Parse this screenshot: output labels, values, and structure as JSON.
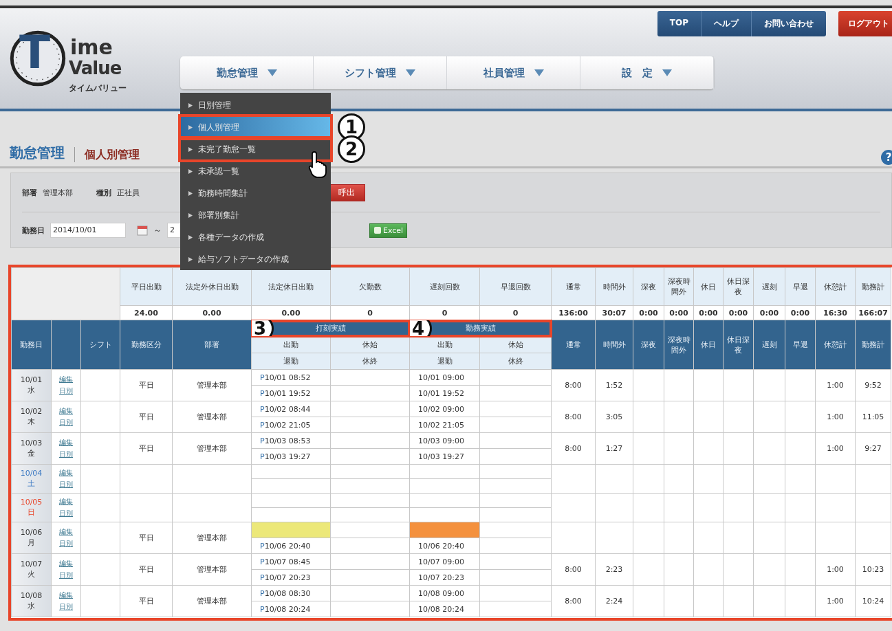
{
  "logo": {
    "letter": "T",
    "line1": "ime",
    "line2": "Value",
    "kana": "タイムバリュー"
  },
  "top_links": [
    {
      "label": "TOP"
    },
    {
      "label": "ヘルプ"
    },
    {
      "label": "お問い合わせ"
    }
  ],
  "logout": "ログアウト",
  "nav": [
    {
      "label": "勤怠管理"
    },
    {
      "label": "シフト管理"
    },
    {
      "label": "社員管理"
    },
    {
      "label": "設　定"
    }
  ],
  "dropdown": [
    {
      "label": "日別管理",
      "selected": false
    },
    {
      "label": "個人別管理",
      "selected": true,
      "callout": "1"
    },
    {
      "label": "未完了勤怠一覧",
      "selected": false,
      "callout": "2"
    },
    {
      "label": "未承認一覧",
      "selected": false
    },
    {
      "label": "勤務時間集計",
      "selected": false
    },
    {
      "label": "部署別集計",
      "selected": false
    },
    {
      "label": "各種データの作成",
      "selected": false
    },
    {
      "label": "給与ソフトデータの作成",
      "selected": false
    }
  ],
  "breadcrumb": {
    "section": "勤怠管理",
    "page": "個人別管理",
    "help": "?"
  },
  "filters": {
    "dept_label": "部署",
    "dept": "管理本部",
    "type_label": "種別",
    "type": "正社員",
    "call_button": "呼出",
    "date_label": "勤務日",
    "date_from": "2014/10/01",
    "range_sep": "～",
    "date_to": "2",
    "excel_button": "Excel"
  },
  "summary": [
    {
      "label": "平日出勤",
      "value": "24.00"
    },
    {
      "label": "法定外休日出勤",
      "value": "0.00"
    },
    {
      "label": "法定休日出勤",
      "value": "0.00"
    },
    {
      "label": "欠勤数",
      "value": "0"
    },
    {
      "label": "遅刻回数",
      "value": "0"
    },
    {
      "label": "早退回数",
      "value": "0"
    },
    {
      "label": "通常",
      "value": "136:00"
    },
    {
      "label": "時間外",
      "value": "30:07"
    },
    {
      "label": "深夜",
      "value": "0:00"
    },
    {
      "label": "深夜時間外",
      "value": "0:00"
    },
    {
      "label": "休日",
      "value": "0:00"
    },
    {
      "label": "休日深夜",
      "value": "0:00"
    },
    {
      "label": "遅刻",
      "value": "0:00"
    },
    {
      "label": "早退",
      "value": "0:00"
    },
    {
      "label": "休憩計",
      "value": "16:30"
    },
    {
      "label": "勤務計",
      "value": "166:07"
    }
  ],
  "headers": {
    "date": "勤務日",
    "shift": "シフト",
    "work_type": "勤務区分",
    "dept": "部署",
    "groups": [
      {
        "label": "打刻実績",
        "callout": "3",
        "in": "出勤",
        "break_start": "休始",
        "out": "退勤",
        "break_end": "休終"
      },
      {
        "label": "勤務実績",
        "callout": "4",
        "in": "出勤",
        "break_start": "休始",
        "out": "退勤",
        "break_end": "休終"
      }
    ],
    "totals": [
      "通常",
      "時間外",
      "深夜",
      "深夜時間外",
      "休日",
      "休日深夜",
      "遅刻",
      "早退",
      "休憩計",
      "勤務計"
    ]
  },
  "rows": [
    {
      "date": "10/01",
      "weekday": "水",
      "kind": "weekday",
      "edit": "編集",
      "daily": "日別",
      "work_type": "平日",
      "dept": "管理本部",
      "punch_in": "P10/01 08:52",
      "punch_out": "P10/01 19:52",
      "actual_in": "10/01 09:00",
      "actual_out": "10/01 19:52",
      "missing_in": false,
      "normal": "8:00",
      "overtime": "1:52",
      "break_total": "1:00",
      "work_total": "9:52"
    },
    {
      "date": "10/02",
      "weekday": "木",
      "kind": "weekday",
      "edit": "編集",
      "daily": "日別",
      "work_type": "平日",
      "dept": "管理本部",
      "punch_in": "P10/02 08:44",
      "punch_out": "P10/02 21:05",
      "actual_in": "10/02 09:00",
      "actual_out": "10/02 21:05",
      "missing_in": false,
      "normal": "8:00",
      "overtime": "3:05",
      "break_total": "1:00",
      "work_total": "11:05"
    },
    {
      "date": "10/03",
      "weekday": "金",
      "kind": "weekday",
      "edit": "編集",
      "daily": "日別",
      "work_type": "平日",
      "dept": "管理本部",
      "punch_in": "P10/03 08:53",
      "punch_out": "P10/03 19:27",
      "actual_in": "10/03 09:00",
      "actual_out": "10/03 19:27",
      "missing_in": false,
      "normal": "8:00",
      "overtime": "1:27",
      "break_total": "1:00",
      "work_total": "9:27"
    },
    {
      "date": "10/04",
      "weekday": "土",
      "kind": "saturday",
      "edit": "編集",
      "daily": "日別",
      "missing_in": false
    },
    {
      "date": "10/05",
      "weekday": "日",
      "kind": "sunday",
      "edit": "編集",
      "daily": "日別",
      "missing_in": false
    },
    {
      "date": "10/06",
      "weekday": "月",
      "kind": "weekday",
      "edit": "編集",
      "daily": "日別",
      "work_type": "平日",
      "dept": "管理本部",
      "punch_out": "P10/06 20:40",
      "actual_out": "10/06 20:40",
      "missing_in": true
    },
    {
      "date": "10/07",
      "weekday": "火",
      "kind": "weekday",
      "edit": "編集",
      "daily": "日別",
      "work_type": "平日",
      "dept": "管理本部",
      "punch_in": "P10/07 08:45",
      "punch_out": "P10/07 20:23",
      "actual_in": "10/07 09:00",
      "actual_out": "10/07 20:23",
      "missing_in": false,
      "normal": "8:00",
      "overtime": "2:23",
      "break_total": "1:00",
      "work_total": "10:23"
    },
    {
      "date": "10/08",
      "weekday": "水",
      "kind": "weekday",
      "edit": "編集",
      "daily": "日別",
      "work_type": "平日",
      "dept": "管理本部",
      "punch_in": "P10/08 08:30",
      "punch_out": "P10/08 20:24",
      "actual_in": "10/08 09:00",
      "actual_out": "10/08 20:24",
      "missing_in": false,
      "normal": "8:00",
      "overtime": "2:24",
      "break_total": "1:00",
      "work_total": "10:24"
    }
  ]
}
